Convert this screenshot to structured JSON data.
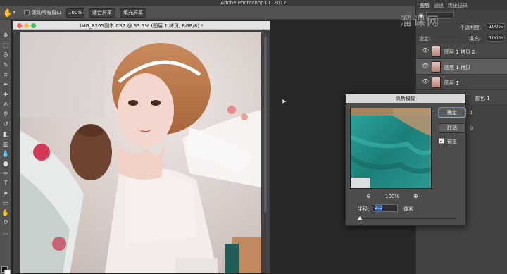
{
  "app": {
    "title": "Adobe Photoshop CC 2017"
  },
  "options_bar": {
    "scroll_all_windows": "滚动所有窗口",
    "zoom_100": "100%",
    "fit_screen": "适合屏幕",
    "fill_screen": "填充屏幕"
  },
  "document": {
    "title": "IMG_8265副本.CR2 @ 33.3% (图层 1 拷贝, RGB/8) *"
  },
  "panel": {
    "tabs": [
      "图层",
      "通道",
      "历史记录"
    ],
    "opacity_label": "不透明度:",
    "opacity_value": "100%",
    "lock_label": "锁定:",
    "fill_label": "填充:",
    "fill_value": "100%",
    "layers": [
      {
        "name": "图层 1 拷贝 2"
      },
      {
        "name": "图层 1 拷贝"
      },
      {
        "name": "图层 1"
      }
    ],
    "partial_layer_name": "颜色 1",
    "partial_number": "1"
  },
  "dialog": {
    "title": "高斯模糊",
    "ok": "确定",
    "cancel": "取消",
    "preview_label": "预览",
    "preview_checked": true,
    "zoom_value": "100%",
    "radius_label": "半径:",
    "radius_value": "2.0",
    "radius_unit": "像素",
    "radius_slider_position": 0.02
  },
  "watermark": "溜课网"
}
